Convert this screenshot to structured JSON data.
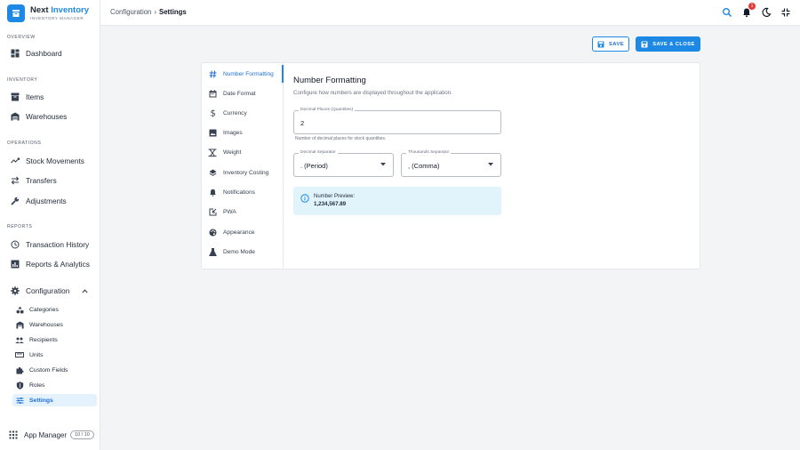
{
  "brand": {
    "name_primary": "Next",
    "name_accent": "Inventory",
    "subtitle": "INVENTORY MANAGER"
  },
  "sections": {
    "overview": "OVERVIEW",
    "inventory": "INVENTORY",
    "operations": "OPERATIONS",
    "reports": "REPORTS"
  },
  "nav": {
    "dashboard": "Dashboard",
    "items": "Items",
    "warehouses": "Warehouses",
    "stock_movements": "Stock Movements",
    "transfers": "Transfers",
    "adjustments": "Adjustments",
    "transaction_history": "Transaction History",
    "reports_analytics": "Reports & Analytics",
    "configuration": "Configuration"
  },
  "config_sub": {
    "categories": "Categories",
    "warehouses": "Warehouses",
    "recipients": "Recipients",
    "units": "Units",
    "custom_fields": "Custom Fields",
    "roles": "Roles",
    "settings": "Settings"
  },
  "app_manager": {
    "label": "App Manager",
    "count": "10 / 10"
  },
  "breadcrumb": {
    "parent": "Configuration",
    "separator": "›",
    "current": "Settings"
  },
  "topbar": {
    "notification_count": "1"
  },
  "actions": {
    "save": "SAVE",
    "save_close": "SAVE & CLOSE"
  },
  "tabs": {
    "number_formatting": "Number Formatting",
    "date_format": "Date Format",
    "currency": "Currency",
    "images": "Images",
    "weight": "Weight",
    "inventory_costing": "Inventory Costing",
    "notifications": "Notifications",
    "pwa": "PWA",
    "appearance": "Appearance",
    "demo_mode": "Demo Mode"
  },
  "panel": {
    "title": "Number Formatting",
    "description": "Configure how numbers are displayed throughout the application.",
    "decimal_places_label": "Decimal Places (Quantities)",
    "decimal_places_value": "2",
    "decimal_places_helper": "Number of decimal places for stock quantities.",
    "decimal_sep_label": "Decimal Separator",
    "decimal_sep_value": ". (Period)",
    "thousands_sep_label": "Thousands Separator",
    "thousands_sep_value": ", (Comma)",
    "preview_label": "Number Preview:",
    "preview_value": "1,234,567.89"
  },
  "colors": {
    "accent": "#1e88e5",
    "preview_bg": "#e1f4fb",
    "badge": "#e53935"
  }
}
